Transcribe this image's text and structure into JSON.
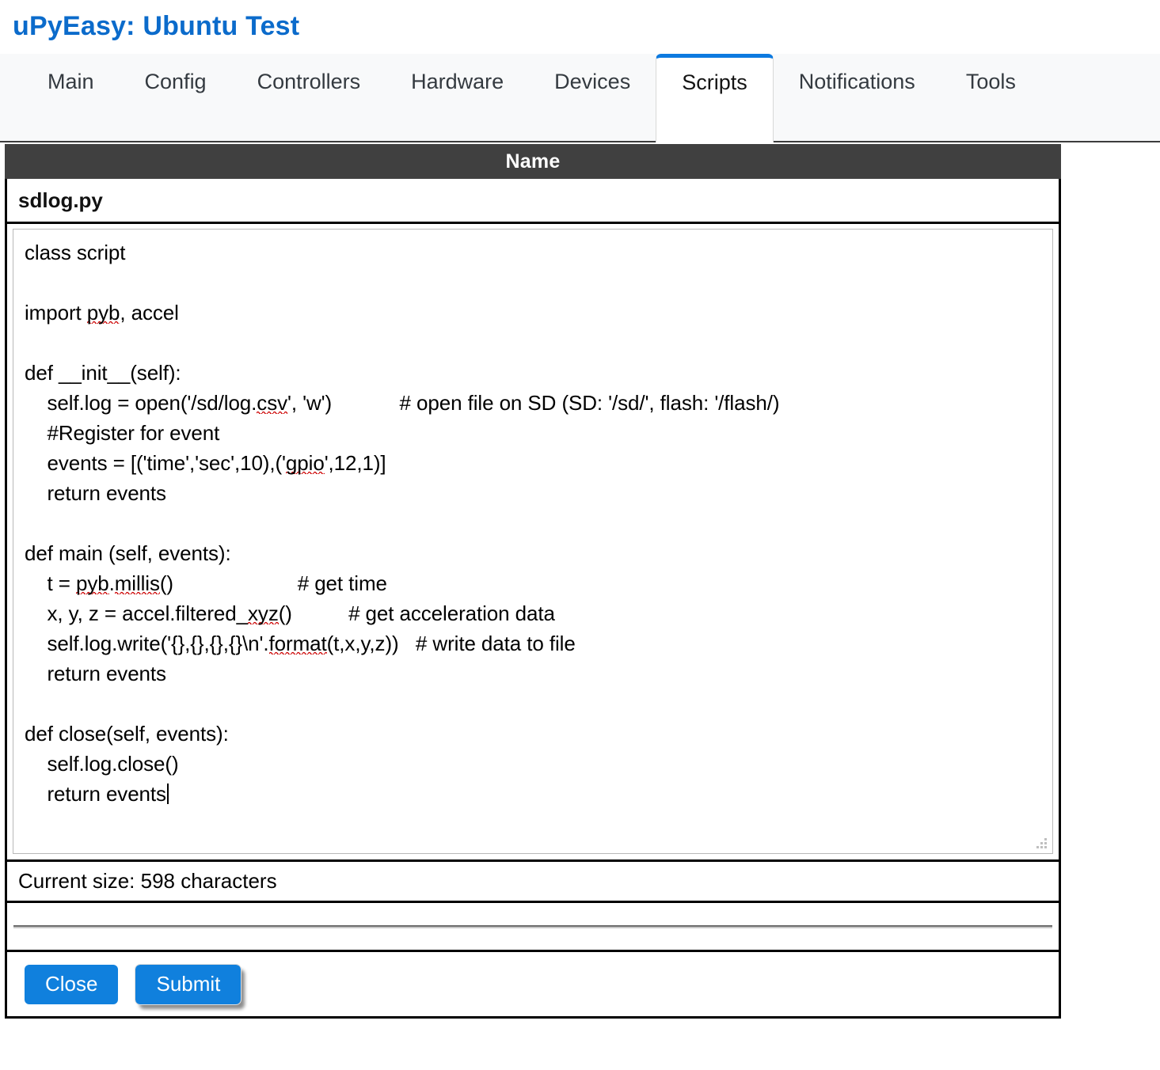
{
  "app": {
    "title": "uPyEasy: Ubuntu Test",
    "title_color": "#0b6bcb"
  },
  "nav": {
    "active_tab": "Scripts",
    "active_border_color": "#0d7ae0",
    "tabs": [
      {
        "label": "Main"
      },
      {
        "label": "Config"
      },
      {
        "label": "Controllers"
      },
      {
        "label": "Hardware"
      },
      {
        "label": "Devices"
      },
      {
        "label": "Scripts"
      },
      {
        "label": "Notifications"
      },
      {
        "label": "Tools"
      }
    ]
  },
  "table": {
    "header": "Name",
    "header_bg": "#404040",
    "filename": "sdlog.py"
  },
  "editor": {
    "value": "class script\n\nimport pyb, accel\n\ndef __init__(self):\n    self.log = open('/sd/log.csv', 'w')            # open file on SD (SD: '/sd/', flash: '/flash/)\n    #Register for event\n    events = [('time','sec',10),('gpio',12,1)]\n    return events\n\ndef main (self, events):\n    t = pyb.millis()                              # get time\n    x, y, z = accel.filtered_xyz()          # get acceleration data\n    self.log.write('{},{},{},{}\\n'.format(t,x,y,z))   # write data to file\n    return events\n\ndef close(self, events):\n    self.log.close()\n    return events",
    "lines": [
      "class script",
      "",
      "import pyb, accel",
      "",
      "def __init__(self):",
      "    self.log = open('/sd/log.csv', 'w')",
      "    #Register for event",
      "    events = [('time','sec',10),('gpio',12,1)]",
      "    return events",
      "",
      "def main (self, events):",
      "    t = pyb.millis()",
      "    x, y, z = accel.filtered_xyz()",
      "    self.log.write('{},{},{},{}\\n'.format(t,x,y,z))",
      "    return events",
      "",
      "def close(self, events):",
      "    self.log.close()",
      "    return events"
    ],
    "comments": {
      "open_file": "# open file on SD (SD: '/sd/', flash: '/flash/)",
      "get_time": "# get time",
      "get_accel": "# get acceleration data",
      "write_data": "# write data to file"
    },
    "misspelled_words": [
      "pyb",
      "csv",
      "gpio",
      "millis",
      "xyz",
      "format"
    ],
    "squiggle_color": "#cc0000",
    "resize_handle": "resize-grip-icon"
  },
  "status": {
    "size_text": "Current size: 598 characters"
  },
  "footer": {
    "close_label": "Close",
    "submit_label": "Submit",
    "button_color": "#1080dd"
  }
}
